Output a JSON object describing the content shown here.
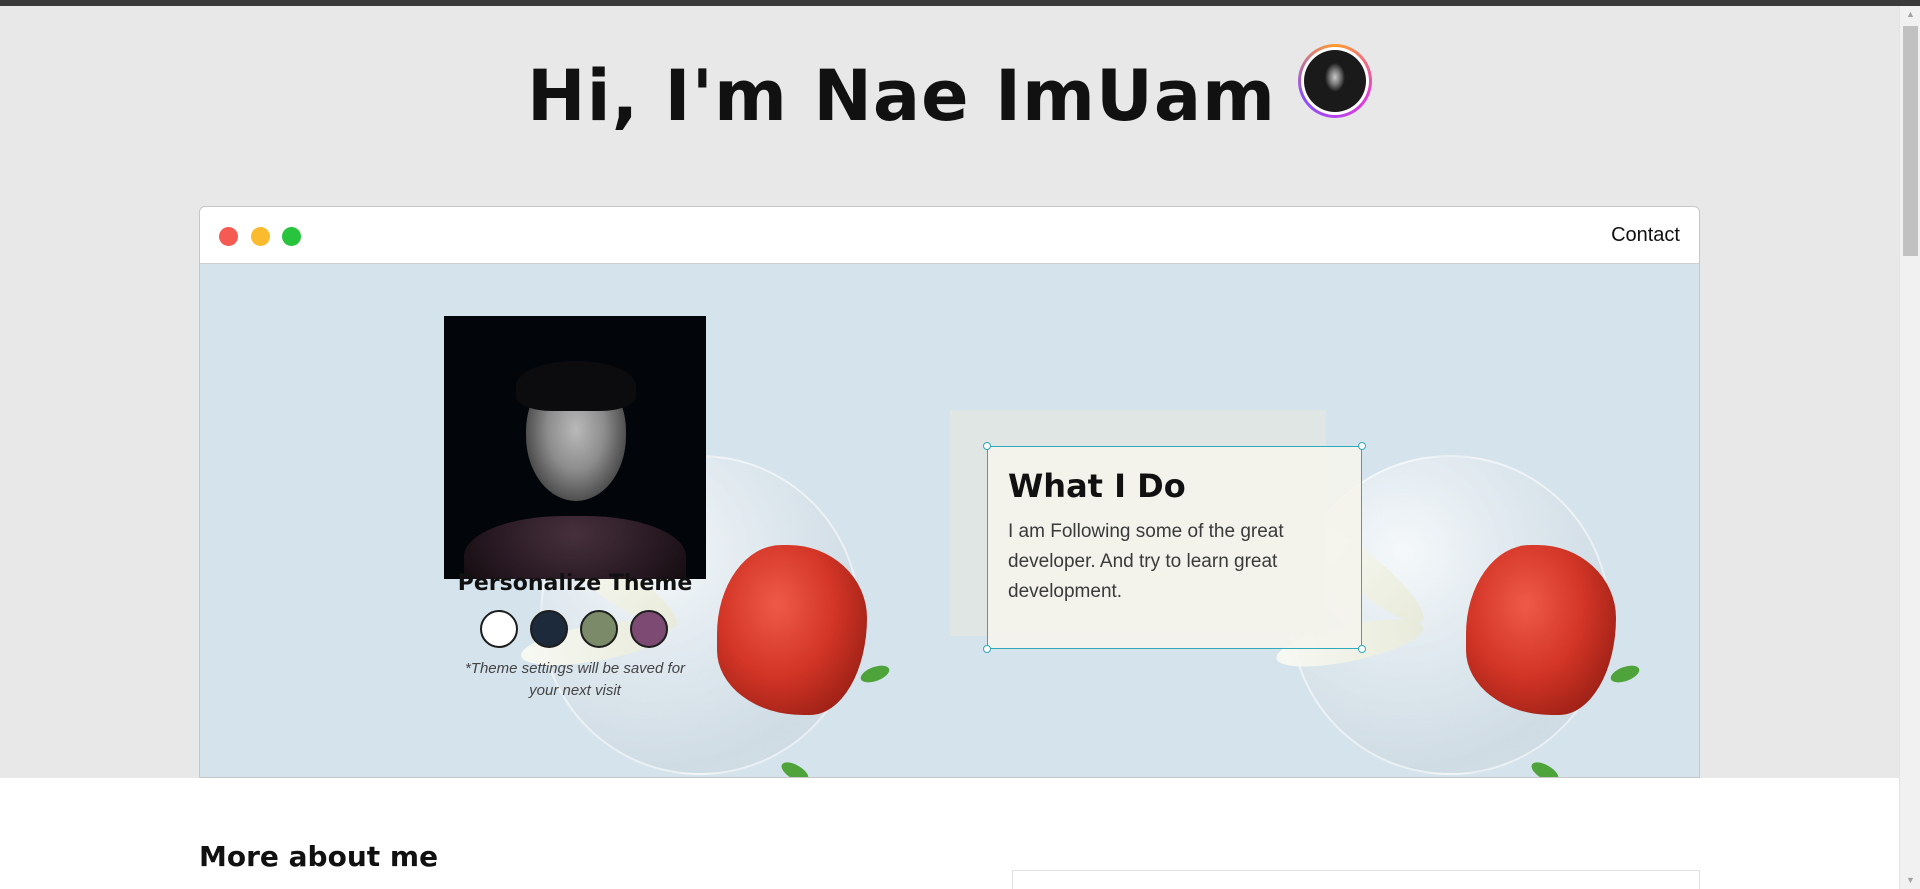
{
  "header": {
    "title": "Hi, I'm Nae ImUam",
    "avatar": "avatar-photo"
  },
  "window": {
    "controls": [
      "close",
      "minimize",
      "maximize"
    ],
    "nav": {
      "contact_label": "Contact"
    }
  },
  "theme": {
    "title": "Personalize Theme",
    "swatches": [
      {
        "name": "white",
        "color": "#ffffff"
      },
      {
        "name": "navy",
        "color": "#1c2a3b"
      },
      {
        "name": "olive",
        "color": "#7b8b69"
      },
      {
        "name": "purple",
        "color": "#7d4a74"
      }
    ],
    "note": "*Theme settings will be saved for your next visit"
  },
  "what_i_do": {
    "title": "What I Do",
    "text": "I am Following some of the great developer. And try to learn great development."
  },
  "about": {
    "title": "More about me"
  },
  "colors": {
    "page_bg": "#e8e8e8",
    "window_body_bg": "#d5e3ec",
    "dot_red": "#f55b53",
    "dot_yellow": "#fbbb2f",
    "dot_green": "#29c43e",
    "selection": "#2eaaba"
  }
}
